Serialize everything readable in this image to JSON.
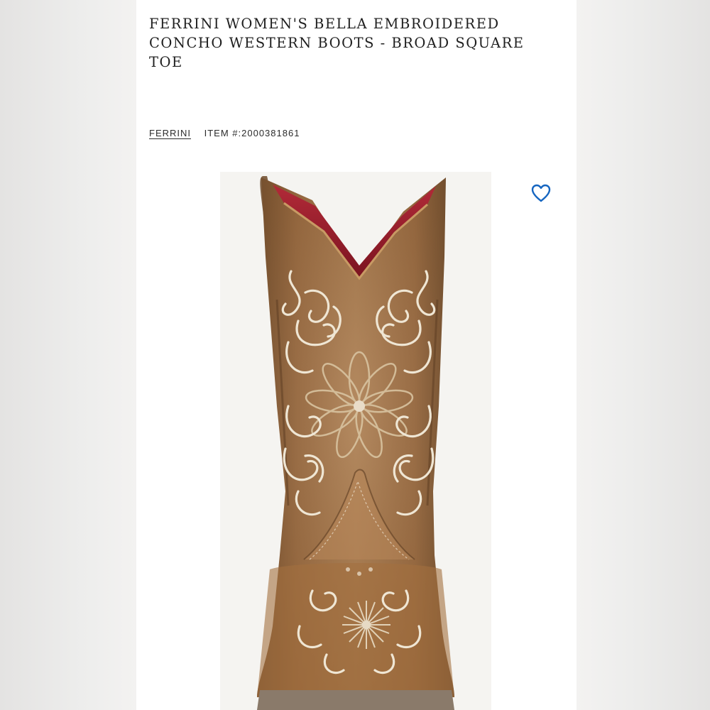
{
  "product": {
    "title": "FERRINI WOMEN'S BELLA EMBROIDERED CONCHO WESTERN BOOTS - BROAD SQUARE TOE",
    "brand_label": "FERRINI",
    "item_number": "ITEM #:2000381861"
  },
  "image": {
    "alt": "Ferrini Women's Bella embroidered western boot, front view"
  },
  "icons": {
    "favorite": "heart-outline-icon"
  },
  "colors": {
    "favorite_icon": "#1565c0",
    "leather": "#9c6b3f",
    "embroidery": "#efe6d4",
    "lining": "#9e1b2a"
  }
}
